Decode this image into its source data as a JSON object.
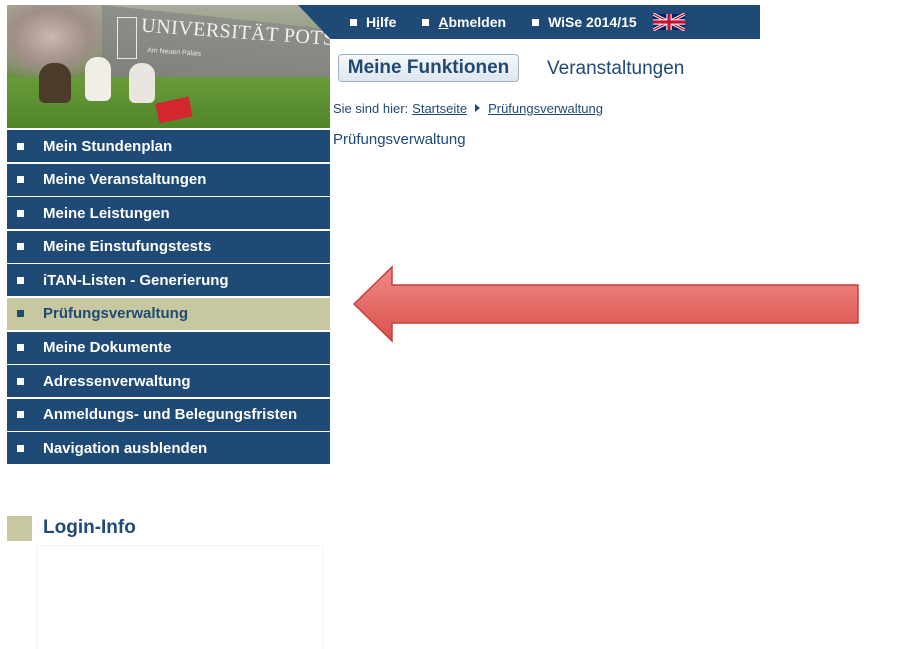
{
  "header": {
    "logo_text": "UNIVERSITÄT POTSDAM",
    "logo_subtext": "Am Neuen Palais"
  },
  "topbar": {
    "help_pre": "H",
    "help_underline": "i",
    "help_post": "lfe",
    "logout_underline": "A",
    "logout_post": "bmelden",
    "semester": "WiSe 2014/15",
    "language_icon": "uk-flag-icon"
  },
  "tabs": {
    "active": "Meine Funktionen",
    "other": "Veranstaltungen"
  },
  "breadcrumb": {
    "prefix": "Sie sind hier:",
    "home": "Startseite",
    "current": "Prüfungsverwaltung"
  },
  "page_title": "Prüfungsverwaltung",
  "sidebar": {
    "items": [
      {
        "label": "Mein Stundenplan"
      },
      {
        "label": "Meine Veranstaltungen"
      },
      {
        "label": "Meine Leistungen"
      },
      {
        "label": "Meine Einstufungstests"
      },
      {
        "label": "iTAN-Listen - Generierung"
      },
      {
        "label": "Prüfungsverwaltung",
        "active": true
      },
      {
        "label": "Meine Dokumente"
      },
      {
        "label": "Adressenverwaltung"
      },
      {
        "label": "Anmeldungs- und Belegungsfristen"
      },
      {
        "label": "Navigation ausblenden"
      }
    ]
  },
  "login_info": {
    "title": "Login-Info"
  },
  "colors": {
    "primary": "#1e4a75",
    "active_nav": "#c8c8a0",
    "annotation_arrow": "#e0625f"
  }
}
